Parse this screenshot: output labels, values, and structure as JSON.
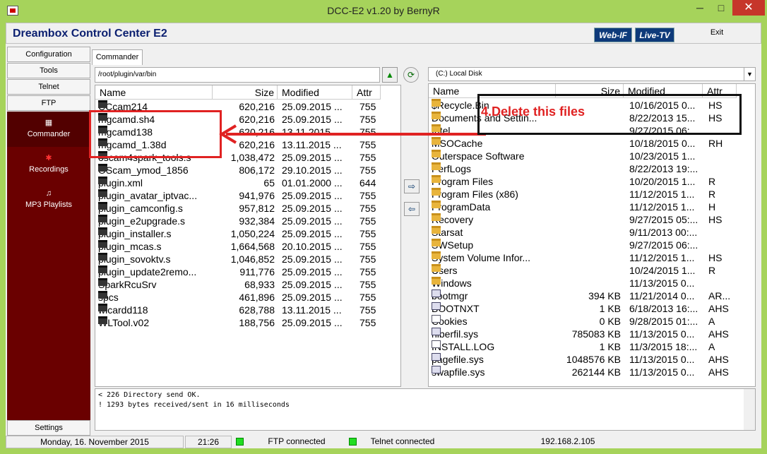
{
  "window": {
    "title": "DCC-E2 v1.20 by BernyR",
    "min": "─",
    "max": "□",
    "close": "✕"
  },
  "header": {
    "app_title": "Dreambox Control Center E2",
    "badge1": "Web-IF",
    "badge2": "Live-TV",
    "exit": "Exit"
  },
  "sidebar": {
    "buttons": [
      "Configuration",
      "Tools",
      "Telnet",
      "FTP"
    ],
    "dark_items": [
      {
        "label": "Commander",
        "icon": "grid-icon"
      },
      {
        "label": "Recordings",
        "icon": "people-icon"
      },
      {
        "label": "MP3 Playlists",
        "icon": "music-icon"
      }
    ],
    "settings": "Settings"
  },
  "tab": "Commander",
  "left": {
    "path": "/root/plugin/var/bin",
    "headers": [
      "Name",
      "Size",
      "Modified",
      "Attr"
    ],
    "rows": [
      {
        "name": "CCcam214",
        "size": "620,216",
        "mod": "25.09.2015 ...",
        "attr": "755"
      },
      {
        "name": "mgcamd.sh4",
        "size": "620,216",
        "mod": "25.09.2015 ...",
        "attr": "755"
      },
      {
        "name": "mgcamd138",
        "size": "620,216",
        "mod": "13.11.2015 ...",
        "attr": "755"
      },
      {
        "name": "mgcamd_1.38d",
        "size": "620,216",
        "mod": "13.11.2015 ...",
        "attr": "755"
      },
      {
        "name": "oscam4spark_tools.s",
        "size": "1,038,472",
        "mod": "25.09.2015 ...",
        "attr": "755"
      },
      {
        "name": "OScam_ymod_1856",
        "size": "806,172",
        "mod": "29.10.2015 ...",
        "attr": "755"
      },
      {
        "name": "plugin.xml",
        "size": "65",
        "mod": "01.01.2000 ...",
        "attr": "644"
      },
      {
        "name": "plugin_avatar_iptvac...",
        "size": "941,976",
        "mod": "25.09.2015 ...",
        "attr": "755"
      },
      {
        "name": "plugin_camconfig.s",
        "size": "957,812",
        "mod": "25.09.2015 ...",
        "attr": "755"
      },
      {
        "name": "plugin_e2upgrade.s",
        "size": "932,384",
        "mod": "25.09.2015 ...",
        "attr": "755"
      },
      {
        "name": "plugin_installer.s",
        "size": "1,050,224",
        "mod": "25.09.2015 ...",
        "attr": "755"
      },
      {
        "name": "plugin_mcas.s",
        "size": "1,664,568",
        "mod": "20.10.2015 ...",
        "attr": "755"
      },
      {
        "name": "plugin_sovoktv.s",
        "size": "1,046,852",
        "mod": "25.09.2015 ...",
        "attr": "755"
      },
      {
        "name": "plugin_update2remo...",
        "size": "911,776",
        "mod": "25.09.2015 ...",
        "attr": "755"
      },
      {
        "name": "SparkRcuSrv",
        "size": "68,933",
        "mod": "25.09.2015 ...",
        "attr": "755"
      },
      {
        "name": "spcs",
        "size": "461,896",
        "mod": "25.09.2015 ...",
        "attr": "755"
      },
      {
        "name": "wicardd118",
        "size": "628,788",
        "mod": "13.11.2015 ...",
        "attr": "755"
      },
      {
        "name": "WLTool.v02",
        "size": "188,756",
        "mod": "25.09.2015 ...",
        "attr": "755"
      }
    ]
  },
  "right": {
    "drive": "(C:)  Local Disk",
    "headers": [
      "Name",
      "Size",
      "Modified",
      "Attr"
    ],
    "rows": [
      {
        "name": "$Recycle.Bin",
        "size": "",
        "mod": "10/16/2015 0...",
        "attr": "HS",
        "kind": "folder"
      },
      {
        "name": "Documents and Settin...",
        "size": "",
        "mod": "8/22/2013 15...",
        "attr": "HS",
        "kind": "folder"
      },
      {
        "name": "Intel",
        "size": "",
        "mod": "9/27/2015 06:...",
        "attr": "",
        "kind": "folder"
      },
      {
        "name": "MSOCache",
        "size": "",
        "mod": "10/18/2015 0...",
        "attr": "RH",
        "kind": "folder"
      },
      {
        "name": "Outerspace Software",
        "size": "",
        "mod": "10/23/2015 1...",
        "attr": "",
        "kind": "folder"
      },
      {
        "name": "PerfLogs",
        "size": "",
        "mod": "8/22/2013 19:...",
        "attr": "",
        "kind": "folder"
      },
      {
        "name": "Program Files",
        "size": "",
        "mod": "10/20/2015 1...",
        "attr": "R",
        "kind": "folder"
      },
      {
        "name": "Program Files (x86)",
        "size": "",
        "mod": "11/12/2015 1...",
        "attr": "R",
        "kind": "folder"
      },
      {
        "name": "ProgramData",
        "size": "",
        "mod": "11/12/2015 1...",
        "attr": "H",
        "kind": "folder"
      },
      {
        "name": "Recovery",
        "size": "",
        "mod": "9/27/2015 05:...",
        "attr": "HS",
        "kind": "folder"
      },
      {
        "name": "Starsat",
        "size": "",
        "mod": "9/11/2013 00:...",
        "attr": "",
        "kind": "folder"
      },
      {
        "name": "SWSetup",
        "size": "",
        "mod": "9/27/2015 06:...",
        "attr": "",
        "kind": "folder"
      },
      {
        "name": "System Volume Infor...",
        "size": "",
        "mod": "11/12/2015 1...",
        "attr": "HS",
        "kind": "folder"
      },
      {
        "name": "Users",
        "size": "",
        "mod": "10/24/2015 1...",
        "attr": "R",
        "kind": "folder"
      },
      {
        "name": "Windows",
        "size": "",
        "mod": "11/13/2015 0...",
        "attr": "",
        "kind": "folder"
      },
      {
        "name": "bootmgr",
        "size": "394 KB",
        "mod": "11/21/2014 0...",
        "attr": "AR...",
        "kind": "cfg"
      },
      {
        "name": "BOOTNXT",
        "size": "1 KB",
        "mod": "6/18/2013 16:...",
        "attr": "AHS",
        "kind": "cfg"
      },
      {
        "name": "Cookies",
        "size": "0 KB",
        "mod": "9/28/2015 01:...",
        "attr": "A",
        "kind": "doc"
      },
      {
        "name": "hiberfil.sys",
        "size": "785083 KB",
        "mod": "11/13/2015 0...",
        "attr": "AHS",
        "kind": "cfg"
      },
      {
        "name": "INSTALL.LOG",
        "size": "1 KB",
        "mod": "11/3/2015 18:...",
        "attr": "A",
        "kind": "doc"
      },
      {
        "name": "pagefile.sys",
        "size": "1048576 KB",
        "mod": "11/13/2015 0...",
        "attr": "AHS",
        "kind": "cfg"
      },
      {
        "name": "swapfile.sys",
        "size": "262144 KB",
        "mod": "11/13/2015 0...",
        "attr": "AHS",
        "kind": "cfg"
      }
    ]
  },
  "log": [
    "< 226 Directory send OK.",
    "! 1293 bytes received/sent in 16 milliseconds"
  ],
  "annotation": "4.Delete this files",
  "status": {
    "date": "Monday, 16. November 2015",
    "time": "21:26",
    "ftp": "FTP connected",
    "telnet": "Telnet connected",
    "ip": "192.168.2.105"
  },
  "colors": {
    "accent": "#a6d35b",
    "sidebar_dark": "#6a0000",
    "annotation_red": "#e02222"
  }
}
